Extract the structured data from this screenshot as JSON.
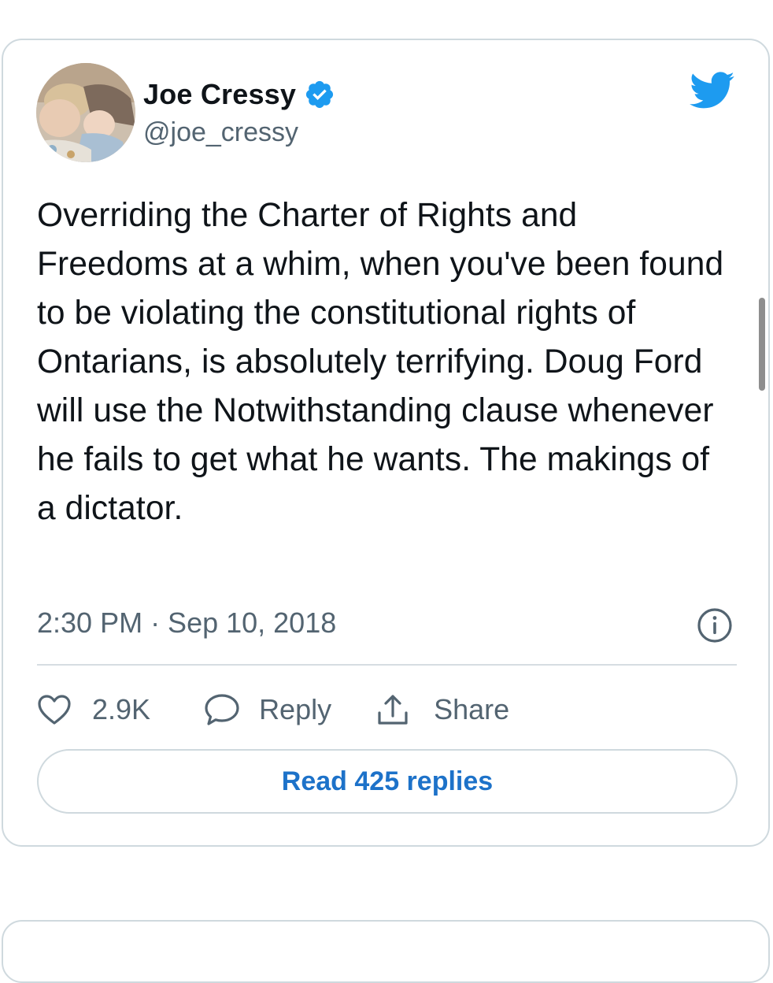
{
  "tweet": {
    "author": {
      "display_name": "Joe Cressy",
      "handle": "@joe_cressy",
      "verified": true,
      "avatar_icon": "avatar-photo"
    },
    "text": "Overriding the Charter of Rights and Freedoms at a whim, when you've been found to be violating the constitutional rights of Ontarians, is absolutely terrifying. Doug Ford will use the Notwithstanding clause whenever he fails to get what he wants. The makings of a dictator.",
    "timestamp": "2:30 PM · Sep 10, 2018",
    "actions": {
      "like_count": "2.9K",
      "reply_label": "Reply",
      "share_label": "Share"
    },
    "read_replies_label": "Read 425 replies"
  },
  "colors": {
    "twitter_blue": "#1d9bf0",
    "link_blue": "#1d72c9",
    "secondary_text": "#536471",
    "border": "#cfd9de"
  },
  "icons": [
    "twitter-bird-icon",
    "verified-badge-icon",
    "info-icon",
    "heart-icon",
    "reply-bubble-icon",
    "share-icon"
  ]
}
